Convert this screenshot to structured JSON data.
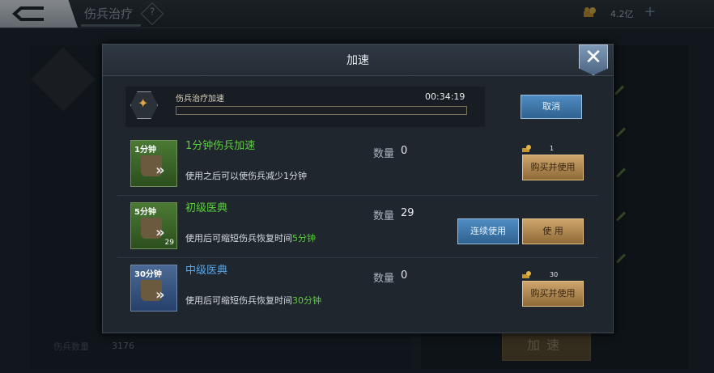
{
  "topbar": {
    "title": "伤兵治疗",
    "help": "?",
    "resource_amount": "4.2亿"
  },
  "background": {
    "count_label": "伤兵数量",
    "count_value": "3176",
    "accelerate_label": "加速"
  },
  "dialog": {
    "title": "加速",
    "close": "✕",
    "progress": {
      "label": "伤兵治疗加速",
      "time": "00:34:19"
    },
    "cancel_label": "取消",
    "qty_label": "数量",
    "items": [
      {
        "icon_tag": "1分钟",
        "icon_count": "",
        "name": "1分钟伤兵加速",
        "desc_prefix": "使用之后可以使伤兵减少1分钟",
        "desc_highlight": "",
        "qty": "0",
        "price": "1",
        "buy_label": "购买并使用"
      },
      {
        "icon_tag": "5分钟",
        "icon_count": "29",
        "name": "初级医典",
        "desc_prefix": "使用后可缩短伤兵恢复时间",
        "desc_highlight": "5分钟",
        "qty": "29",
        "continuous_label": "连续使用",
        "use_label": "使 用"
      },
      {
        "icon_tag": "30分钟",
        "icon_count": "",
        "name": "中级医典",
        "desc_prefix": "使用后可缩短伤兵恢复时间",
        "desc_highlight": "30分钟",
        "qty": "0",
        "price": "30",
        "buy_label": "购买并使用"
      }
    ]
  },
  "colors": {
    "name_green": "#5ccf3c",
    "name_blue": "#5ba7e6",
    "gold": "#cda56c",
    "accent_blue": "#4f8cc3"
  }
}
